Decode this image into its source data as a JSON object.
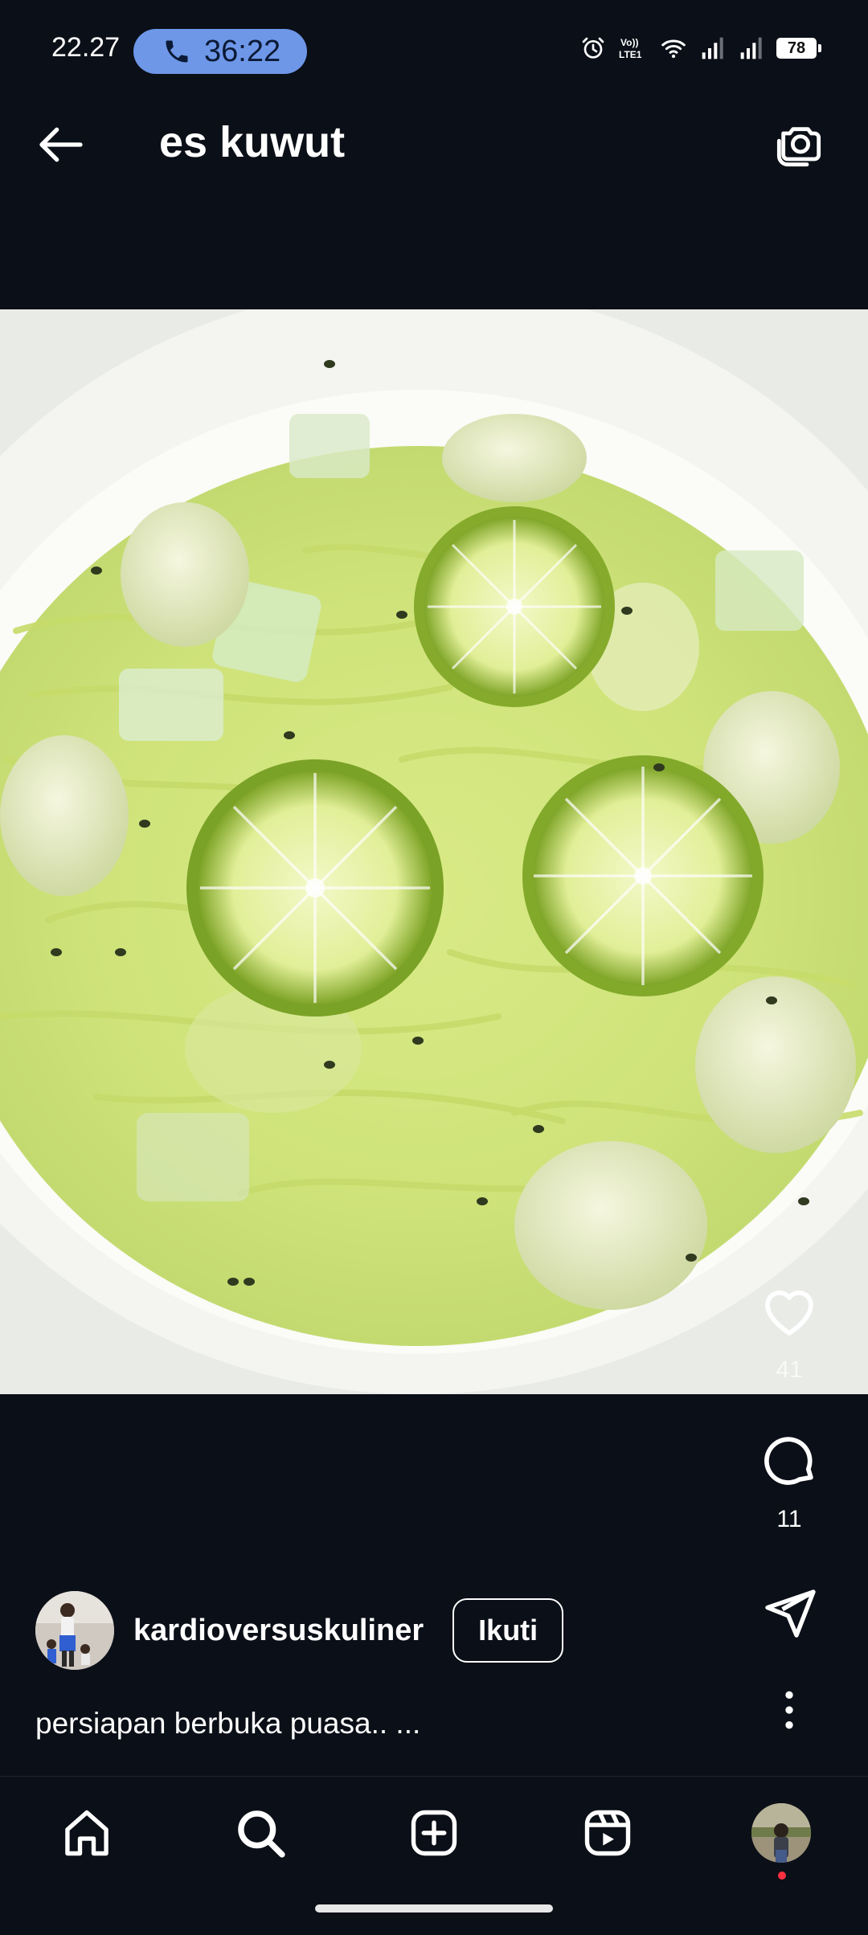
{
  "status_bar": {
    "time": "22.27",
    "call_duration": "36:22",
    "battery": "78",
    "icons": [
      "phone-icon",
      "alarm-icon",
      "volte-icon",
      "wifi-icon",
      "signal-icon",
      "signal-icon",
      "battery-icon"
    ]
  },
  "header": {
    "title": "es kuwut",
    "back_icon": "arrow-left-icon",
    "camera_icon": "camera-icon"
  },
  "post": {
    "likes": "41",
    "comments": "11",
    "author": "kardioversuskuliner",
    "follow_label": "Ikuti",
    "caption": "persiapan berbuka puasa.. ..."
  },
  "bottom_nav": {
    "items": [
      "home-icon",
      "search-icon",
      "create-icon",
      "reels-icon",
      "profile-avatar"
    ]
  }
}
